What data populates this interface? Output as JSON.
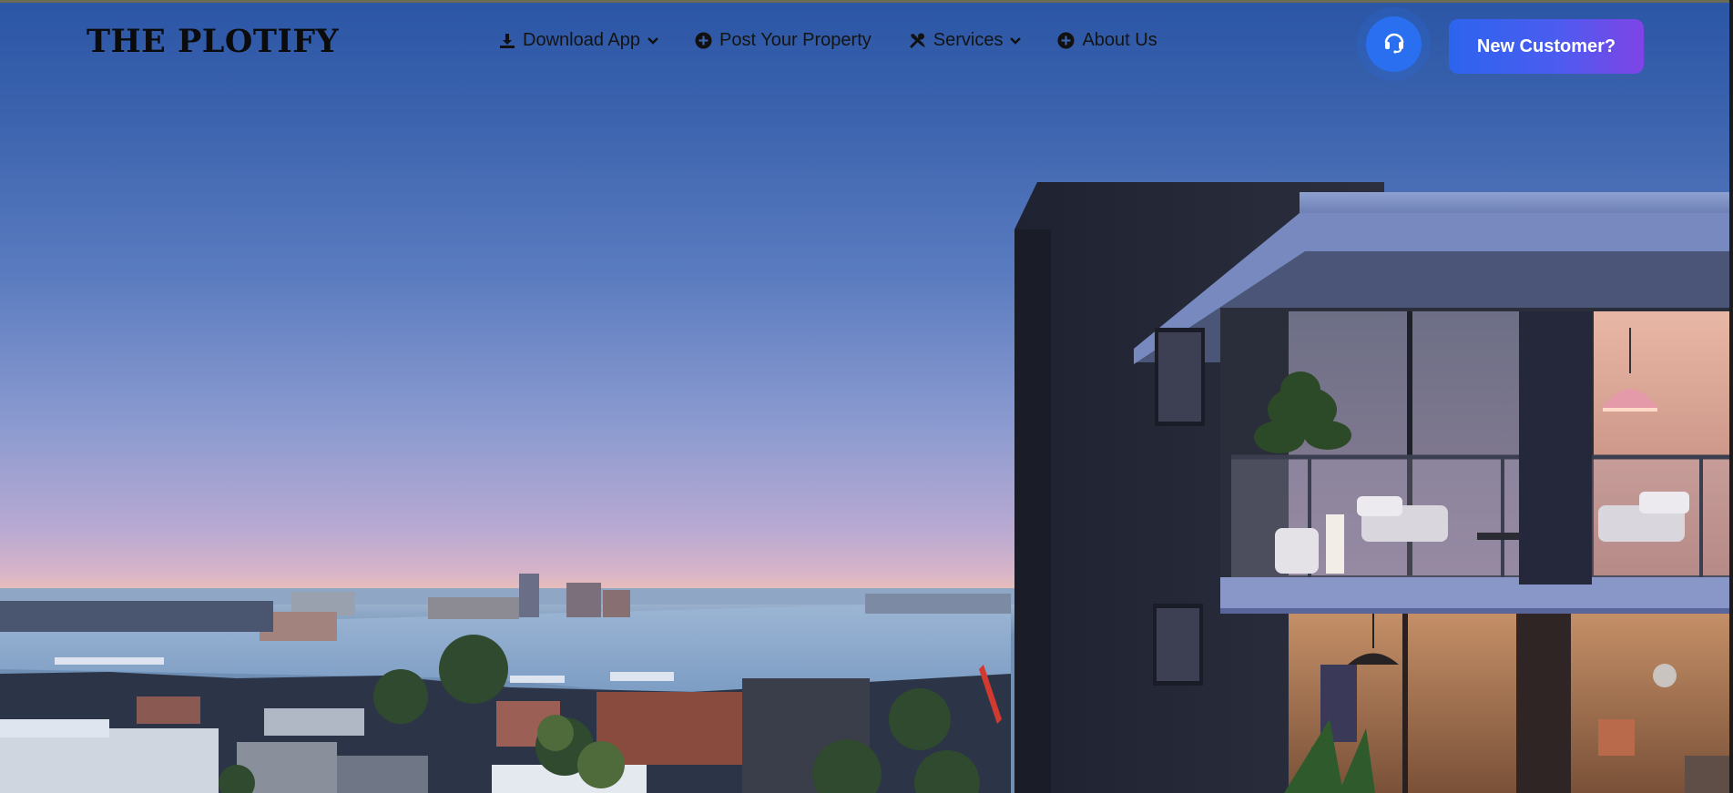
{
  "brand": {
    "name": "THE PLOTIFY"
  },
  "nav": {
    "items": [
      {
        "label": "Download App",
        "icon": "download-icon",
        "has_dropdown": true
      },
      {
        "label": "Post Your Property",
        "icon": "plus-circle-icon",
        "has_dropdown": false
      },
      {
        "label": "Services",
        "icon": "tools-icon",
        "has_dropdown": true
      },
      {
        "label": "About Us",
        "icon": "plus-circle-icon",
        "has_dropdown": false
      }
    ]
  },
  "actions": {
    "support_icon": "headset-icon",
    "cta_label": "New Customer?"
  },
  "colors": {
    "support_button": "#2a6ff0",
    "cta_gradient_start": "#2c64ee",
    "cta_gradient_end": "#7f44e6",
    "brand_text": "#0b0b0b"
  },
  "hero": {
    "image": "dusk city harbour view with modern apartment building"
  }
}
